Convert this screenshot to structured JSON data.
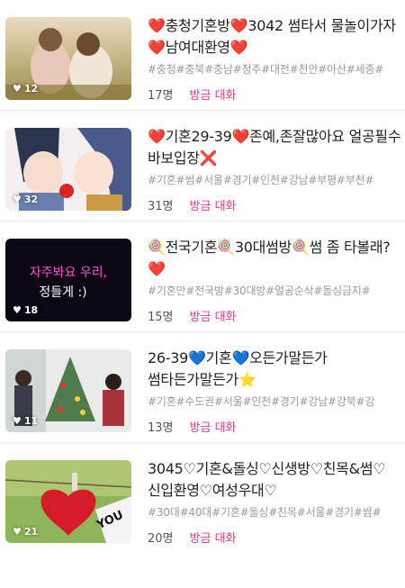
{
  "rooms": [
    {
      "title": "❤️충청기혼방❤️3042 썸타서 물놀이가자❤️남여대환영❤️",
      "tags": "#충청#충북#충남#청주#대전#천안#아산#세종#",
      "likes": "12",
      "members": "17명",
      "activity": "방금 대화",
      "thumb_icon": "couple-field-image"
    },
    {
      "title": "❤️기혼29-39❤️존예,존잘많아요 얼공필수 바보입장❌",
      "tags": "#기혼#썸#서울#경기#인천#강남#부평#부천#",
      "likes": "32",
      "members": "31명",
      "activity": "방금 대화",
      "thumb_icon": "kissing-couple-illustration"
    },
    {
      "title": "🍭전국기혼🍭30대썸방🍭썸 좀 타볼래?❤️",
      "tags": "#기혼만#전국방#30대방#얼공순삭#돌싱금지#",
      "likes": "18",
      "members": "15명",
      "activity": "방금 대화",
      "thumb_icon": "neon-sign-image",
      "thumb_text_1": "자주봐요 우리,",
      "thumb_text_2": "정들게 :)"
    },
    {
      "title": "26-39💙기혼💙오든가말든가 썸타든가말든가⭐",
      "tags": "#기혼#수도권#서울#인천#경기#강남#강북#강",
      "likes": "11",
      "members": "13명",
      "activity": "방금 대화",
      "thumb_icon": "christmas-tree-image"
    },
    {
      "title": "3045♡기혼&돌싱♡신생방♡친목&썸♡신입환영♡여성우대♡",
      "tags": "#30대#40대#기혼#돌싱#친목#서울#경기#썸#",
      "likes": "21",
      "members": "20명",
      "activity": "방금 대화",
      "thumb_icon": "red-heart-clip-image",
      "thumb_text_1": "YOU"
    }
  ]
}
